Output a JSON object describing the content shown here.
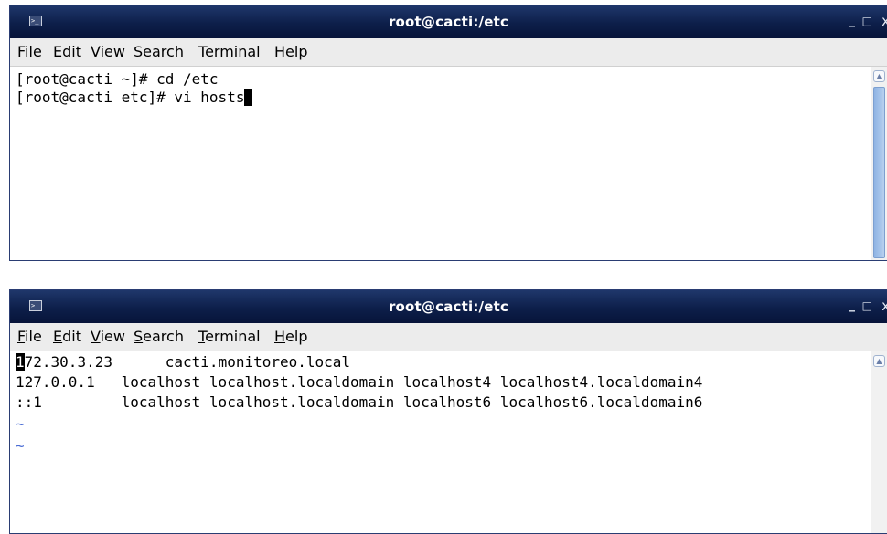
{
  "windows": [
    {
      "title": "root@cacti:/etc",
      "app_icon": "terminal-icon",
      "controls": {
        "minimize": "_",
        "maximize": "□",
        "close": "x"
      },
      "menu": [
        {
          "label": "File",
          "accel": "F",
          "rest": "ile"
        },
        {
          "label": "Edit",
          "accel": "E",
          "rest": "dit"
        },
        {
          "label": "View",
          "accel": "V",
          "rest": "iew"
        },
        {
          "label": "Search",
          "accel": "S",
          "rest": "earch"
        },
        {
          "label": "Terminal",
          "accel": "T",
          "rest": "erminal"
        },
        {
          "label": "Help",
          "accel": "H",
          "rest": "elp"
        }
      ],
      "terminal": {
        "lines": [
          "[root@cacti ~]# cd /etc",
          "[root@cacti etc]# vi hosts"
        ]
      }
    },
    {
      "title": "root@cacti:/etc",
      "app_icon": "terminal-icon",
      "controls": {
        "minimize": "_",
        "maximize": "□",
        "close": "x"
      },
      "menu": [
        {
          "label": "File",
          "accel": "F",
          "rest": "ile"
        },
        {
          "label": "Edit",
          "accel": "E",
          "rest": "dit"
        },
        {
          "label": "View",
          "accel": "V",
          "rest": "iew"
        },
        {
          "label": "Search",
          "accel": "S",
          "rest": "earch"
        },
        {
          "label": "Terminal",
          "accel": "T",
          "rest": "erminal"
        },
        {
          "label": "Help",
          "accel": "H",
          "rest": "elp"
        }
      ],
      "terminal": {
        "cursor_char": "1",
        "lines": [
          "72.30.3.23      cacti.monitoreo.local",
          "127.0.0.1   localhost localhost.localdomain localhost4 localhost4.localdomain4",
          "::1         localhost localhost.localdomain localhost6 localhost6.localdomain6",
          "~",
          "~"
        ]
      }
    }
  ],
  "colors": {
    "titlebar": "#0d1f4a",
    "tilde": "#4a6cd4",
    "scroll_thumb": "#8eb3e3"
  }
}
